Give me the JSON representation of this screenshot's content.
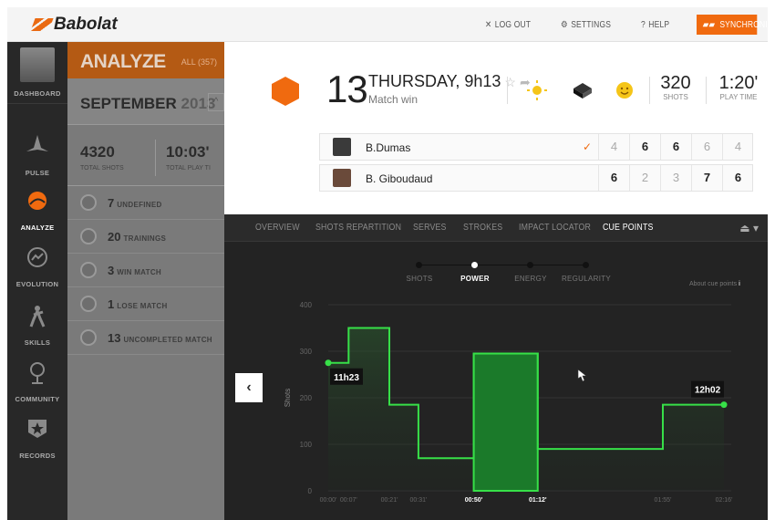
{
  "brand": {
    "name": "Babolat"
  },
  "topbar": {
    "logout": "LOG OUT",
    "settings": "SETTINGS",
    "help": "HELP",
    "sync": "SYNCHRONIZE"
  },
  "nav": [
    {
      "label": "DASHBOARD",
      "icon": "avatar"
    },
    {
      "label": "PULSE",
      "icon": "pulse-icon"
    },
    {
      "label": "ANALYZE",
      "icon": "analyze-icon"
    },
    {
      "label": "EVOLUTION",
      "icon": "evolution-icon"
    },
    {
      "label": "SKILLS",
      "icon": "skills-icon"
    },
    {
      "label": "COMMUNITY",
      "icon": "community-icon"
    },
    {
      "label": "RECORDS",
      "icon": "records-icon"
    }
  ],
  "analyze": {
    "title": "ANALYZE",
    "all": "ALL (357)",
    "month": "SEPTEMBER",
    "year": "2013",
    "total_shots": "4320",
    "total_shots_label": "TOTAL SHOTS",
    "total_play": "10:03'",
    "total_play_label": "TOTAL PLAY TI",
    "filters": [
      {
        "count": "7",
        "label": "UNDEFINED"
      },
      {
        "count": "20",
        "label": "TRAININGS"
      },
      {
        "count": "3",
        "label": "WIN MATCH"
      },
      {
        "count": "1",
        "label": "LOSE MATCH"
      },
      {
        "count": "13",
        "label": "UNCOMPLETED MATCH"
      }
    ]
  },
  "match": {
    "day": "13",
    "date": "THURSDAY, 9h13",
    "result": "Match win",
    "shots": "320",
    "shots_label": "SHOTS",
    "playtime": "1:20'",
    "playtime_label": "PLAY TIME",
    "players": [
      {
        "name": "B.Dumas",
        "winner": true,
        "scores": [
          "4",
          "6",
          "6",
          "6",
          "4"
        ],
        "bold": [
          false,
          true,
          true,
          false,
          false
        ]
      },
      {
        "name": "B. Giboudaud",
        "winner": false,
        "scores": [
          "6",
          "2",
          "3",
          "7",
          "6"
        ],
        "bold": [
          true,
          false,
          false,
          true,
          true
        ]
      }
    ]
  },
  "tabs": [
    "OVERVIEW",
    "SHOTS REPARTITION",
    "SERVES",
    "STROKES",
    "IMPACT LOCATOR",
    "CUE POINTS"
  ],
  "active_tab": "CUE POINTS",
  "steps": [
    "SHOTS",
    "POWER",
    "ENERGY",
    "REGULARITY"
  ],
  "active_step": "POWER",
  "about": "About cue points",
  "chart_data": {
    "type": "area",
    "ylabel": "Shots",
    "ylim": [
      0,
      400
    ],
    "yticks": [
      0,
      100,
      200,
      300,
      400
    ],
    "x_ticks": [
      "00:00'",
      "00:07'",
      "00:21'",
      "00:31'",
      "00:50'",
      "01:12'",
      "01:55'",
      "02:16'"
    ],
    "bold_ticks": [
      "00:50'",
      "01:12'"
    ],
    "steps": [
      {
        "from": 0,
        "to": 7,
        "value": 275
      },
      {
        "from": 7,
        "to": 21,
        "value": 350
      },
      {
        "from": 21,
        "to": 31,
        "value": 185
      },
      {
        "from": 31,
        "to": 38,
        "value": 70
      },
      {
        "from": 38,
        "to": 50,
        "value": 70
      },
      {
        "from": 50,
        "to": 72,
        "value": 295
      },
      {
        "from": 72,
        "to": 115,
        "value": 90
      },
      {
        "from": 115,
        "to": 136,
        "value": 185
      }
    ],
    "highlight": {
      "from": 50,
      "to": 72
    },
    "labels": [
      {
        "text": "11h23",
        "at": 0
      },
      {
        "text": "12h02",
        "at": 136
      }
    ],
    "colors": {
      "line": "#37e048",
      "fill": "#1b7a2a"
    }
  }
}
